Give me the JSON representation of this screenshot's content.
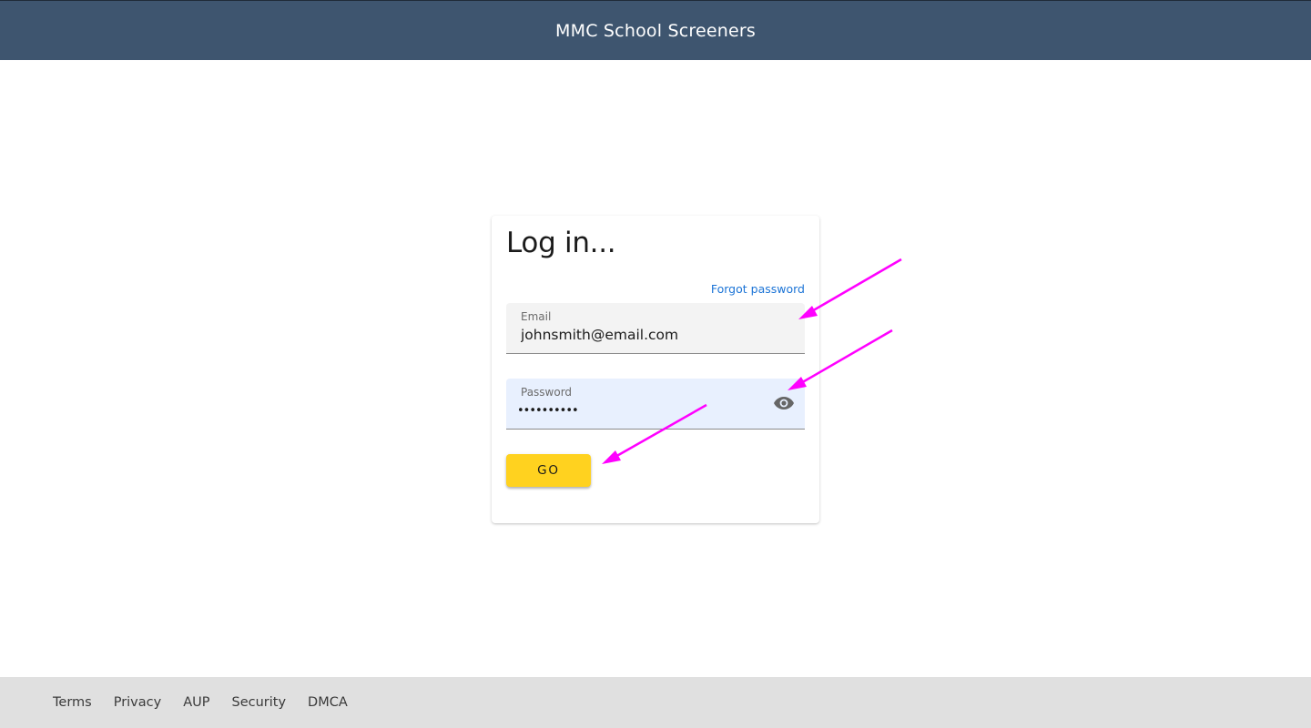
{
  "app_bar": {
    "title": "MMC School Screeners",
    "background": "#3e556f"
  },
  "login_card": {
    "title": "Log in...",
    "forgot_password": "Forgot password",
    "email": {
      "label": "Email",
      "value": "johnsmith@email.com"
    },
    "password": {
      "label": "Password",
      "value": "••••••••••",
      "toggle_icon": "eye-icon"
    },
    "submit_label": "GO"
  },
  "footer": {
    "links": [
      "Terms",
      "Privacy",
      "AUP",
      "Security",
      "DMCA"
    ]
  },
  "colors": {
    "accent_button": "#ffd21f",
    "link": "#1a73d6",
    "annotation_arrow": "#ff00ff",
    "password_field_bg": "#e8f0fe",
    "email_field_bg": "#f3f3f3",
    "footer_bg": "#e0e0e0"
  },
  "annotations": [
    {
      "icon": "arrow-icon",
      "target": "email-field"
    },
    {
      "icon": "arrow-icon",
      "target": "password-field"
    },
    {
      "icon": "arrow-icon",
      "target": "go-button"
    }
  ]
}
